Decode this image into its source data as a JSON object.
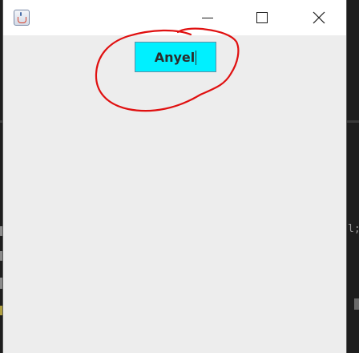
{
  "window": {
    "icon": "java-icon",
    "controls": {
      "minimize_icon": "minimize-icon",
      "maximize_icon": "maximize-icon",
      "close_icon": "close-icon"
    }
  },
  "content": {
    "button_label": "Anyel",
    "button_color": "#00f0ff"
  },
  "background": {
    "edge_text": "l;"
  },
  "annotation": {
    "shape": "hand-drawn circle",
    "color": "#e01010"
  }
}
